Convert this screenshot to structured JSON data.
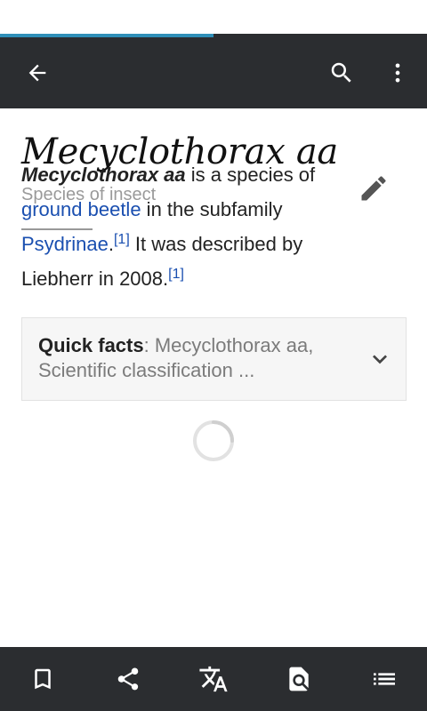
{
  "load_progress": 0.5,
  "colors": {
    "toolbar_bg": "#2b2d30",
    "progress": "#2f8fb8",
    "link": "#1a4fb0",
    "text": "#222222",
    "muted": "#9a9a9a"
  },
  "toolbar": {
    "icons": [
      "back-arrow-icon",
      "search-icon",
      "more-vert-icon"
    ]
  },
  "article": {
    "title": "Mecyclothorax aa",
    "description": "Species of insect",
    "lead": {
      "name": "Mecyclothorax aa",
      "text1": " is a species of ",
      "link1": "ground beetle",
      "text2": " in the subfamily ",
      "link2": "Psydrinae",
      "text3": ".",
      "ref1": "[1]",
      "text4": " It was described by Liebherr in 2008.",
      "ref2": "[1]"
    }
  },
  "quick_facts": {
    "label": "Quick facts",
    "summary": ": Mecyclothorax aa, Scientific classification ..."
  },
  "bottom_bar": {
    "icons": [
      "bookmark-icon",
      "share-icon",
      "translate-icon",
      "find-in-page-icon",
      "contents-list-icon"
    ]
  }
}
